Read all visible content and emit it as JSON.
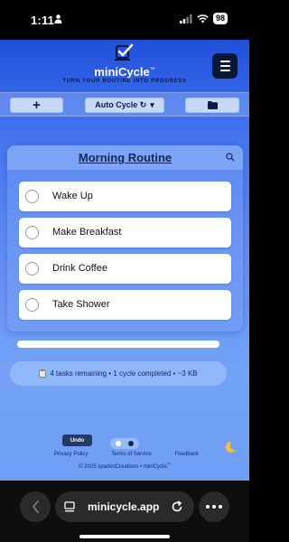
{
  "status_bar": {
    "time": "1:11",
    "battery": "98"
  },
  "app": {
    "title": "miniCycle",
    "title_mark": "™",
    "tagline": "TURN YOUR ROUTINE INTO PROGRESS"
  },
  "toolbar": {
    "add_label": "+",
    "cycle_mode": "Auto Cycle ↻",
    "cycle_caret": "▾"
  },
  "routine": {
    "title": "Morning Routine",
    "tasks": [
      {
        "label": "Wake Up",
        "done": false
      },
      {
        "label": "Make Breakfast",
        "done": false
      },
      {
        "label": "Drink Coffee",
        "done": false
      },
      {
        "label": "Take Shower",
        "done": false
      }
    ]
  },
  "progress": {
    "completed_fraction": 0
  },
  "stats": {
    "text": "4 tasks remaining • 1 cycle completed • ~3 KB"
  },
  "footer": {
    "undo_label": "Undo",
    "links": [
      "Privacy Policy",
      "Terms of Service",
      "Feedback"
    ],
    "copyright": "© 2025 sparkinCreations • miniCycle",
    "copyright_mark": "™"
  },
  "browser": {
    "url": "minicycle.app"
  },
  "colors": {
    "accent_dark": "#0b1738",
    "gradient_top": "#1f4fd8",
    "gradient_bottom": "#74a2f6",
    "title_text": "#12265e"
  }
}
